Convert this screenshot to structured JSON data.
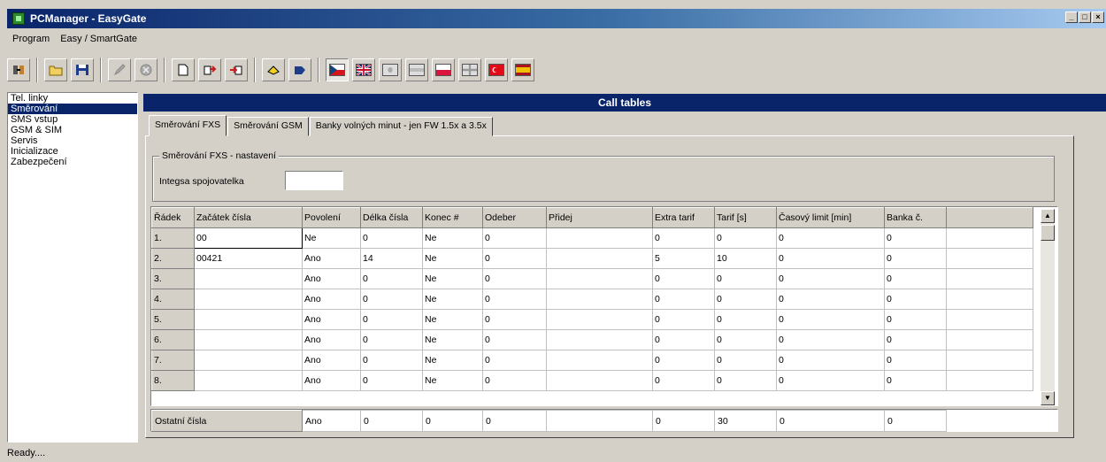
{
  "window": {
    "title": "PCManager - EasyGate",
    "controls": [
      "_",
      "□",
      "×"
    ]
  },
  "menu": [
    "Program",
    "Easy / SmartGate"
  ],
  "toolbar": [
    {
      "icon": "connect-icon"
    },
    {
      "sep": true
    },
    {
      "icon": "open-folder-icon"
    },
    {
      "icon": "save-icon"
    },
    {
      "sep": true
    },
    {
      "icon": "pencil-icon"
    },
    {
      "icon": "stop-icon"
    },
    {
      "sep": true
    },
    {
      "icon": "new-document-icon"
    },
    {
      "icon": "export-icon"
    },
    {
      "icon": "import-icon"
    },
    {
      "sep": true
    },
    {
      "icon": "read-icon"
    },
    {
      "icon": "write-icon"
    },
    {
      "sep": true
    },
    {
      "icon": "flag-czech-icon",
      "pressed": true
    },
    {
      "icon": "flag-uk-icon"
    },
    {
      "icon": "flag-generic-icon"
    },
    {
      "icon": "flag-generic2-icon"
    },
    {
      "icon": "flag-poland-icon"
    },
    {
      "icon": "flag-cross-icon"
    },
    {
      "icon": "flag-turkey-icon"
    },
    {
      "icon": "flag-spain-icon"
    }
  ],
  "sidebar": {
    "items": [
      {
        "label": "Tel. linky"
      },
      {
        "label": "Směrování",
        "selected": true
      },
      {
        "label": "SMS vstup"
      },
      {
        "label": "GSM & SIM"
      },
      {
        "label": "Servis"
      },
      {
        "label": "Inicializace"
      },
      {
        "label": "Zabezpečení"
      }
    ]
  },
  "panel": {
    "title": "Call tables"
  },
  "tabs": [
    {
      "label": "Směrování FXS",
      "active": true
    },
    {
      "label": "Směrování GSM"
    },
    {
      "label": "Banky volných minut - jen FW 1.5x a 3.5x"
    }
  ],
  "settings": {
    "group_title": "Směrování FXS - nastavení",
    "integra_label": "Integsa spojovatelka",
    "integra_value": ""
  },
  "grid": {
    "columns": [
      "Řádek",
      "Začátek čísla",
      "Povolení",
      "Délka čísla",
      "Konec #",
      "Odeber",
      "Přidej",
      "Extra tarif",
      "Tarif [s]",
      "Časový limit [min]",
      "Banka č."
    ],
    "rows": [
      [
        "1.",
        "00",
        "Ne",
        "0",
        "Ne",
        "0",
        "",
        "0",
        "0",
        "0",
        "0"
      ],
      [
        "2.",
        "00421",
        "Ano",
        "14",
        "Ne",
        "0",
        "",
        "5",
        "10",
        "0",
        "0"
      ],
      [
        "3.",
        "",
        "Ano",
        "0",
        "Ne",
        "0",
        "",
        "0",
        "0",
        "0",
        "0"
      ],
      [
        "4.",
        "",
        "Ano",
        "0",
        "Ne",
        "0",
        "",
        "0",
        "0",
        "0",
        "0"
      ],
      [
        "5.",
        "",
        "Ano",
        "0",
        "Ne",
        "0",
        "",
        "0",
        "0",
        "0",
        "0"
      ],
      [
        "6.",
        "",
        "Ano",
        "0",
        "Ne",
        "0",
        "",
        "0",
        "0",
        "0",
        "0"
      ],
      [
        "7.",
        "",
        "Ano",
        "0",
        "Ne",
        "0",
        "",
        "0",
        "0",
        "0",
        "0"
      ],
      [
        "8.",
        "",
        "Ano",
        "0",
        "Ne",
        "0",
        "",
        "0",
        "0",
        "0",
        "0"
      ]
    ]
  },
  "other_row": [
    "Ostatní čísla",
    "Ano",
    "0",
    "0",
    "0",
    "",
    "0",
    "30",
    "0",
    "0"
  ],
  "status": {
    "text": "Ready...."
  }
}
